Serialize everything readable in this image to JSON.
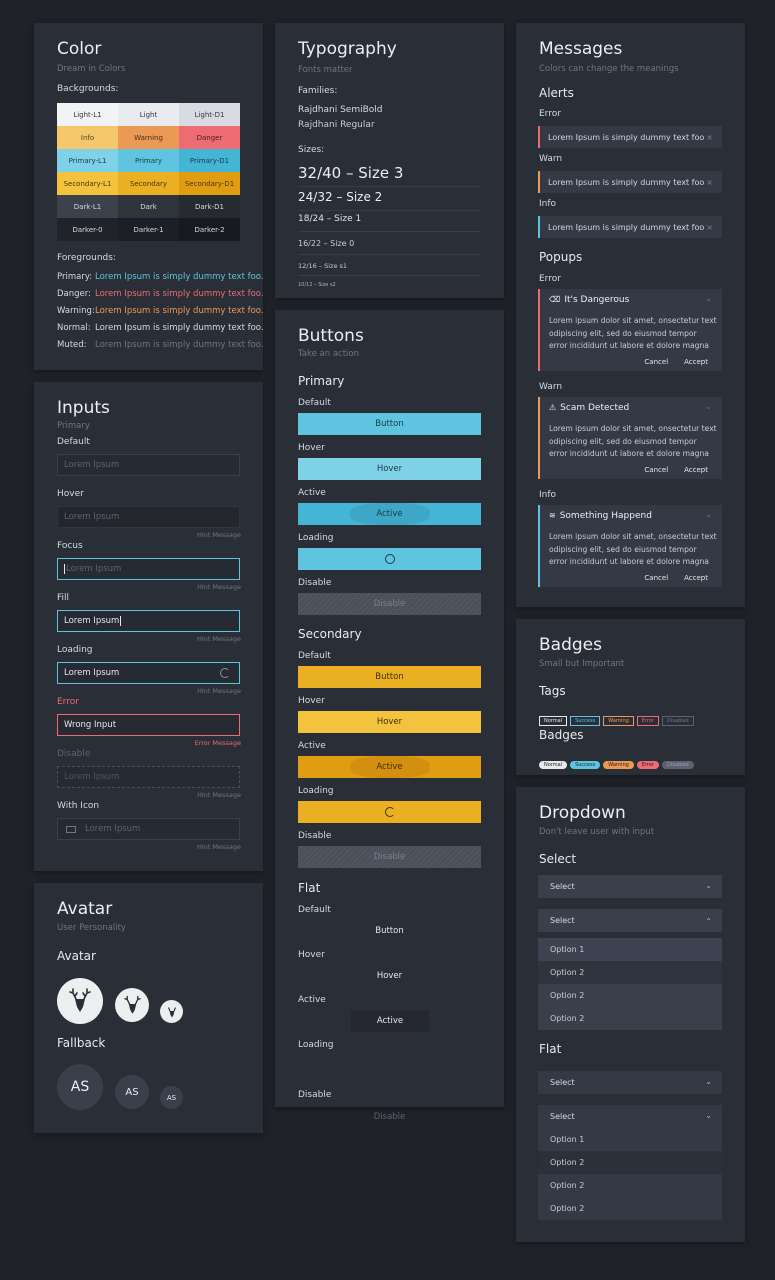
{
  "color": {
    "title": "Color",
    "subtitle": "Dream in Colors",
    "bg_label": "Backgrounds:",
    "swatches": [
      {
        "label": "Light-L1",
        "bg": "#f2f3f5",
        "fg": "#333842"
      },
      {
        "label": "Light",
        "bg": "#eaebef",
        "fg": "#333842"
      },
      {
        "label": "Light-D1",
        "bg": "#d8dbe1",
        "fg": "#333842"
      },
      {
        "label": "Info",
        "bg": "#f4c76a",
        "fg": "#5a4420"
      },
      {
        "label": "Warning",
        "bg": "#eb9a55",
        "fg": "#4a2c14"
      },
      {
        "label": "Danger",
        "bg": "#ec6c72",
        "fg": "#4a1c20"
      },
      {
        "label": "Primary-L1",
        "bg": "#7fd1e8",
        "fg": "#1d3a46"
      },
      {
        "label": "Primary",
        "bg": "#5ec4e0",
        "fg": "#1d3a46"
      },
      {
        "label": "Primary-D1",
        "bg": "#45b5d6",
        "fg": "#1d3a46"
      },
      {
        "label": "Secondary-L1",
        "bg": "#f3c33d",
        "fg": "#4a3710"
      },
      {
        "label": "Secondary",
        "bg": "#ebb021",
        "fg": "#4a3710"
      },
      {
        "label": "Secondary-D1",
        "bg": "#e19d12",
        "fg": "#4a3710"
      },
      {
        "label": "Dark-L1",
        "bg": "#3c414c",
        "fg": "#d6dae1"
      },
      {
        "label": "Dark",
        "bg": "#2f333c",
        "fg": "#d6dae1"
      },
      {
        "label": "Dark-D1",
        "bg": "#262a31",
        "fg": "#d6dae1"
      },
      {
        "label": "Darker-0",
        "bg": "#20232a",
        "fg": "#d6dae1"
      },
      {
        "label": "Darker-1",
        "bg": "#1c1f25",
        "fg": "#d6dae1"
      },
      {
        "label": "Darker-2",
        "bg": "#181a1f",
        "fg": "#d6dae1"
      }
    ],
    "fg_label": "Foregrounds:",
    "foregrounds": [
      {
        "name": "Primary:",
        "text": "Lorem Ipsum is simply dummy text foo.",
        "color": "#5ec4e0"
      },
      {
        "name": "Danger:",
        "text": "Lorem Ipsum is simply dummy text foo.",
        "color": "#ec6c72"
      },
      {
        "name": "Warning:",
        "text": "Lorem Ipsum is simply dummy text foo.",
        "color": "#eb9a55"
      },
      {
        "name": "Normal:",
        "text": "Lorem Ipsum is simply dummy text foo.",
        "color": "#d6dae1"
      },
      {
        "name": "Muted:",
        "text": "Lorem Ipsum is simply dummy text foo.",
        "color": "#6e7584"
      }
    ]
  },
  "inputs": {
    "title": "Inputs",
    "subtitle": "Primary",
    "states": [
      {
        "label": "Default",
        "value": "Lorem Ipsum",
        "hint": ""
      },
      {
        "label": "Hover",
        "value": "Lorem Ipsum",
        "hint": "Hint Message"
      },
      {
        "label": "Focus",
        "value": "Lorem Ipsum",
        "hint": "Hint Message"
      },
      {
        "label": "Fill",
        "value": "Lorem Ipsum",
        "hint": "Hint Message"
      },
      {
        "label": "Loading",
        "value": "Lorem Ipsum",
        "hint": "Hint Message"
      },
      {
        "label": "Error",
        "value": "Wrong Input",
        "hint": "Error Message"
      },
      {
        "label": "Disable",
        "value": "Lorem Ipsum",
        "hint": "Hint Message"
      },
      {
        "label": "With Icon",
        "value": "Lorem Ipsum",
        "hint": "Hint Message"
      }
    ],
    "default_hint": "Hint Message"
  },
  "avatar": {
    "title": "Avatar",
    "subtitle": "User Personality",
    "avatar_label": "Avatar",
    "fallback_label": "Fallback",
    "initials": "AS"
  },
  "typography": {
    "title": "Typography",
    "subtitle": "Fonts matter",
    "families_label": "Families:",
    "families": [
      "Rajdhani SemiBold",
      "Rajdhani Regular"
    ],
    "sizes_label": "Sizes:",
    "sizes": [
      "32/40 – Size 3",
      "24/32 – Size 2",
      "18/24 – Size 1",
      "16/22 – Size 0",
      "12/16 – Size s1",
      "10/12 – Size s2"
    ]
  },
  "buttons": {
    "title": "Buttons",
    "subtitle": "Take an action",
    "primary_label": "Primary",
    "secondary_label": "Secondary",
    "flat_label": "Flat",
    "states": [
      "Default",
      "Hover",
      "Active",
      "Loading",
      "Disable"
    ],
    "texts": {
      "default": "Button",
      "hover": "Hover",
      "active": "Active",
      "disable": "Disable"
    }
  },
  "messages": {
    "title": "Messages",
    "subtitle": "Colors can change the meanings",
    "alerts_label": "Alerts",
    "popups_label": "Popups",
    "alerts": [
      {
        "level": "Error",
        "text": "Lorem Ipsum is simply dummy text foo",
        "color": "#ec6c72"
      },
      {
        "level": "Warn",
        "text": "Lorem Ipsum is simply dummy text foo",
        "color": "#eb9a55"
      },
      {
        "level": "Info",
        "text": "Lorem Ipsum is simply dummy text foo",
        "color": "#5ec4e0"
      }
    ],
    "popups": [
      {
        "level": "Error",
        "title": "It's Dangerous",
        "icon": "trash-icon",
        "color": "#ec6c72"
      },
      {
        "level": "Warn",
        "title": "Scam Detected",
        "icon": "warning-icon",
        "color": "#eb9a55"
      },
      {
        "level": "Info",
        "title": "Something Happend",
        "icon": "signal-icon",
        "color": "#5ec4e0"
      }
    ],
    "popup_body": "Lorem ipsum dolor sit amet, onsectetur text odipiscing elit, sed do eiusmod tempor error incididunt ut labore et dolore magna",
    "cancel": "Cancel",
    "accept": "Accept"
  },
  "badges": {
    "title": "Badges",
    "subtitle": "Small but Important",
    "tags_label": "Tags",
    "badges_label": "Badges",
    "items": [
      {
        "label": "Normal",
        "color": "#e6e8ec"
      },
      {
        "label": "Success",
        "color": "#5ec4e0"
      },
      {
        "label": "Warning",
        "color": "#eb9a55"
      },
      {
        "label": "Error",
        "color": "#ec6c72"
      },
      {
        "label": "Disabled",
        "color": "#5c6270"
      }
    ]
  },
  "dropdown": {
    "title": "Dropdown",
    "subtitle": "Don't leave user with input",
    "select_label": "Select",
    "flat_label": "Flat",
    "placeholder": "Select",
    "options": [
      "Option 1",
      "Option 2",
      "Option 2",
      "Option 2"
    ]
  }
}
